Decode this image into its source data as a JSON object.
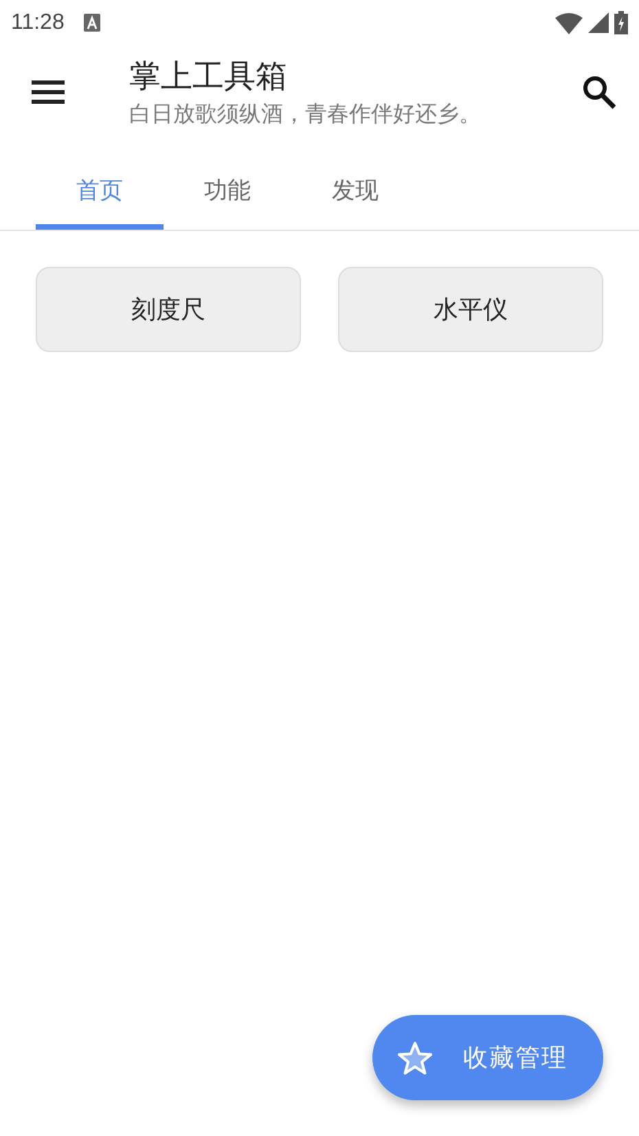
{
  "status_bar": {
    "time": "11:28"
  },
  "app_bar": {
    "title": "掌上工具箱",
    "subtitle": "白日放歌须纵酒，青春作伴好还乡。"
  },
  "tabs": [
    {
      "label": "首页",
      "selected": true
    },
    {
      "label": "功能",
      "selected": false
    },
    {
      "label": "发现",
      "selected": false
    }
  ],
  "tools": [
    "刻度尺",
    "水平仪"
  ],
  "fab": {
    "label": "收藏管理"
  }
}
